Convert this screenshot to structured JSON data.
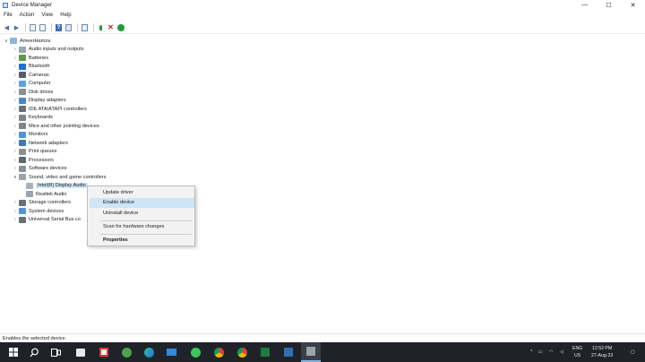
{
  "window": {
    "title": "Device Manager",
    "controls": {
      "minimize": "—",
      "maximize": "☐",
      "close": "✕"
    }
  },
  "menubar": [
    "File",
    "Action",
    "View",
    "Help"
  ],
  "toolbar": {
    "icons": [
      "back-arrow-icon",
      "forward-arrow-icon",
      "properties-icon",
      "help-doc-icon",
      "help-icon",
      "computer-icon",
      "scan-icon",
      "update-driver-icon",
      "uninstall-device-icon",
      "enable-device-icon"
    ]
  },
  "tree": {
    "root": "AmeerHamza",
    "categories": [
      "Audio inputs and outputs",
      "Batteries",
      "Bluetooth",
      "Cameras",
      "Computer",
      "Disk drives",
      "Display adapters",
      "IDE ATA/ATAPI controllers",
      "Keyboards",
      "Mice and other pointing devices",
      "Monitors",
      "Network adapters",
      "Print queues",
      "Processors",
      "Software devices",
      "Sound, video and game controllers"
    ],
    "sound_children": [
      "Intel(R) Display Audio",
      "Realtek Audio"
    ],
    "after": [
      "Storage controllers",
      "System devices",
      "Universal Serial Bus co"
    ]
  },
  "context_menu": {
    "items": [
      "Update driver",
      "Enable device",
      "Uninstall device",
      "Scan for hardware changes",
      "Properties"
    ],
    "highlighted": "Enable device"
  },
  "statusbar": {
    "text": "Enables the selected device."
  },
  "taskbar": {
    "tray": {
      "lang": "ENG",
      "region": "US",
      "time": "12:52 PM",
      "date": "27-Aug-23"
    }
  },
  "colors": {
    "selection": "#cde5f7",
    "taskbar": "#1f2329"
  }
}
